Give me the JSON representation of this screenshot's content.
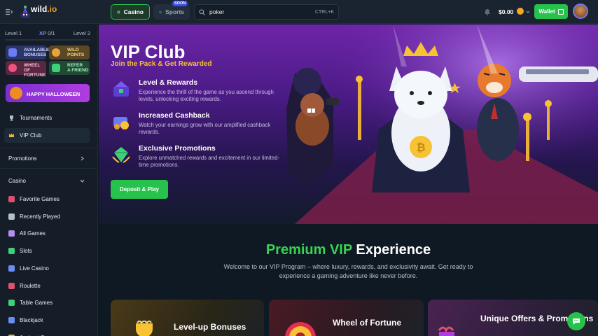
{
  "header": {
    "logo_text": "wild",
    "logo_suffix": ".io",
    "nav_casino": "Casino",
    "nav_sports": "Sports",
    "sports_badge": "SOON",
    "search_value": "poker",
    "search_shortcut": "CTRL+K",
    "balance": "$0.00",
    "wallet_label": "Wallet"
  },
  "sidebar": {
    "level_left": "Level 1",
    "xp_label": "XP",
    "xp_value": "0/1",
    "level_right": "Level 2",
    "xp_progress": 0,
    "tiles": [
      {
        "line1": "Available",
        "line2": "Bonuses"
      },
      {
        "line1": "Wild",
        "line2": "Points"
      },
      {
        "line1": "Wheel",
        "line2": "of Fortune"
      },
      {
        "line1": "Refer",
        "line2": "a Friend"
      }
    ],
    "halloween": "Happy Halloween",
    "items_top": [
      {
        "label": "Tournaments",
        "icon": "trophy-icon",
        "active": false
      },
      {
        "label": "VIP Club",
        "icon": "crown-icon",
        "active": true
      }
    ],
    "promotions_label": "Promotions",
    "casino_label": "Casino",
    "casino_items": [
      {
        "label": "Favorite Games",
        "icon": "heart-icon",
        "color": "#e0506e"
      },
      {
        "label": "Recently Played",
        "icon": "history-icon",
        "color": "#b6c0cc"
      },
      {
        "label": "All Games",
        "icon": "grid-icon",
        "color": "#b58cf0"
      },
      {
        "label": "Slots",
        "icon": "slots-icon",
        "color": "#3fcf78"
      },
      {
        "label": "Live Casino",
        "icon": "live-dealer-icon",
        "color": "#6a8cf5"
      },
      {
        "label": "Roulette",
        "icon": "roulette-icon",
        "color": "#e0506e"
      },
      {
        "label": "Table Games",
        "icon": "table-icon",
        "color": "#3fcf78"
      },
      {
        "label": "Blackjack",
        "icon": "cards-icon",
        "color": "#6a8cf5"
      },
      {
        "label": "Jackpot Games",
        "icon": "jackpot-icon",
        "color": "#f0b030"
      }
    ]
  },
  "hero": {
    "title": "VIP Club",
    "subtitle": "Join the Pack & Get Rewarded",
    "features": [
      {
        "title": "Level & Rewards",
        "desc": "Experience the thrill of the game as you ascend through levels, unlocking exciting rewards."
      },
      {
        "title": "Increased Cashback",
        "desc": "Watch your earnings grow with our amplified cashback rewards."
      },
      {
        "title": "Exclusive Promotions",
        "desc": "Explore unmatched rewards and excitement in our limited-time promotions."
      }
    ],
    "cta": "Deposit & Play"
  },
  "premium": {
    "title_green": "Premium VIP",
    "title_white": "Experience",
    "description": "Welcome to our VIP Program – where luxury, rewards, and exclusivity await. Get ready to experience a gaming adventure like never before.",
    "cards": [
      {
        "title": "Level-up Bonuses"
      },
      {
        "title": "Wheel of Fortune"
      },
      {
        "title": "Unique Offers & Promotions"
      }
    ]
  },
  "colors": {
    "accent_green": "#27c24c",
    "accent_gold": "#f7c234",
    "sidebar_bg": "#151e28"
  }
}
